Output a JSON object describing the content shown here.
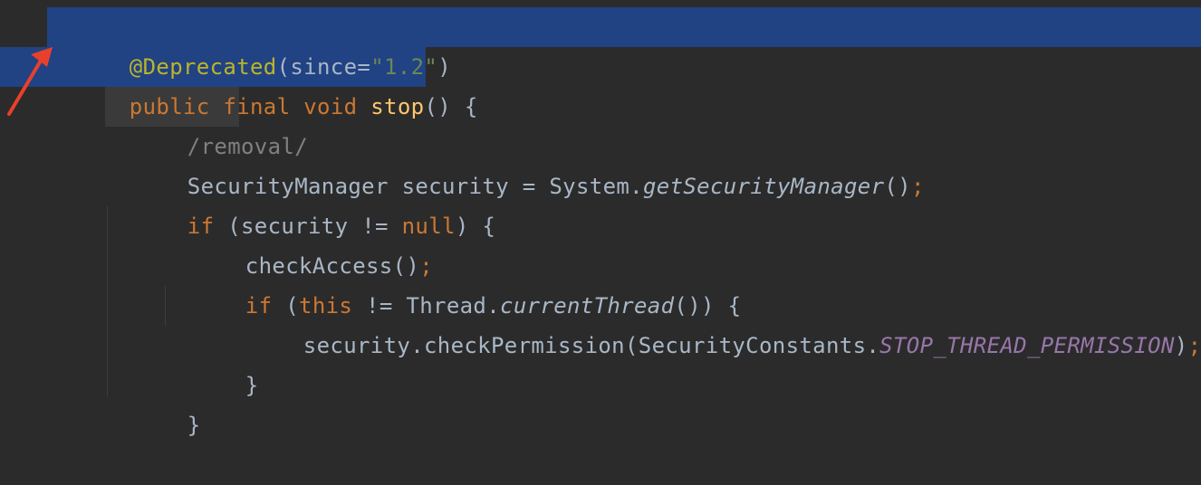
{
  "editor": {
    "lines": [
      {
        "tokens": [
          "@Deprecated",
          "(since=",
          "\"1.2\"",
          ")"
        ]
      },
      {
        "tokens": [
          "public",
          " ",
          "final",
          " ",
          "void",
          " ",
          "stop",
          "() {"
        ]
      },
      {
        "tokens": [
          "/removal/"
        ]
      },
      {
        "tokens": [
          "SecurityManager security = System.",
          "getSecurityManager",
          "()",
          ";"
        ]
      },
      {
        "tokens": [
          "if",
          " (security != ",
          "null",
          ") {"
        ]
      },
      {
        "tokens": [
          "checkAccess()",
          ";"
        ]
      },
      {
        "tokens": [
          "if",
          " (",
          "this",
          " != Thread.",
          "currentThread",
          "()) {"
        ]
      },
      {
        "tokens": [
          "security.checkPermission(SecurityConstants.",
          "STOP_THREAD_PERMISSION",
          ")",
          ";"
        ]
      },
      {
        "tokens": [
          "}"
        ]
      },
      {
        "tokens": [
          "}"
        ]
      }
    ]
  },
  "colors": {
    "background": "#2b2b2b",
    "selection": "#214283",
    "annotation": "#bbb529",
    "keyword": "#cc7832",
    "string": "#6a8759",
    "method_declaration": "#ffc66d",
    "constant": "#9876aa",
    "text": "#a9b7c6",
    "arrow": "#e8402c"
  }
}
